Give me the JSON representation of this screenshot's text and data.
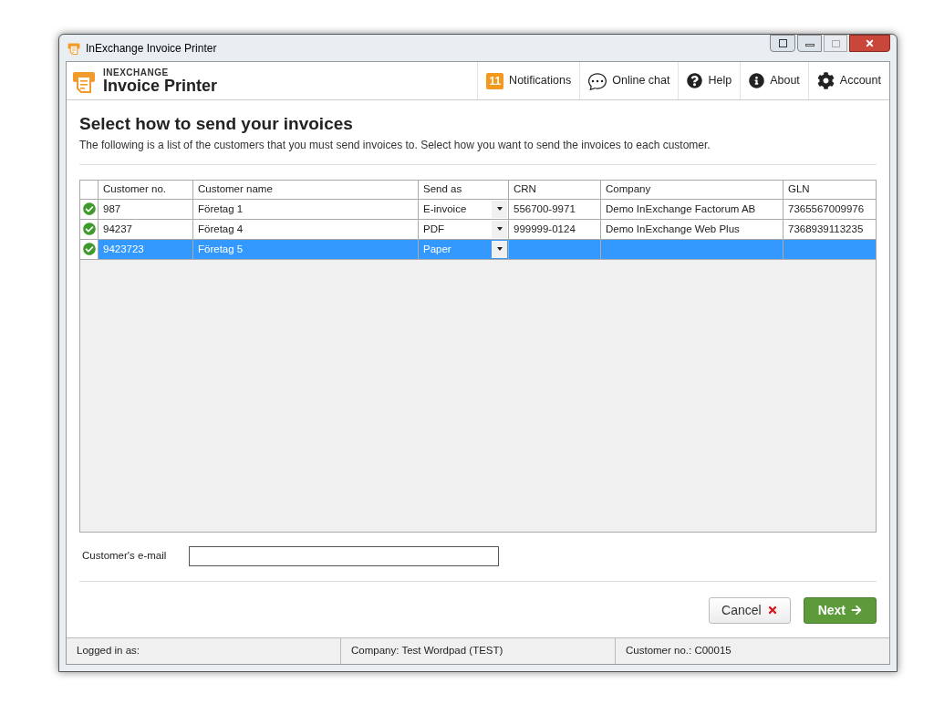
{
  "window": {
    "title": "InExchange Invoice Printer"
  },
  "brand": {
    "top": "INEXCHANGE",
    "name": "Invoice Printer"
  },
  "nav": [
    {
      "kind": "notifications",
      "badge": "11",
      "label": "Notifications"
    },
    {
      "kind": "chat",
      "label": "Online chat"
    },
    {
      "kind": "help",
      "label": "Help"
    },
    {
      "kind": "about",
      "label": "About"
    },
    {
      "kind": "account",
      "label": "Account"
    }
  ],
  "heading": "Select how to send your invoices",
  "subtitle": "The following is a list of the customers that you must send invoices to. Select how you want to send the invoices to each customer.",
  "table": {
    "columns": [
      "Customer no.",
      "Customer name",
      "Send as",
      "CRN",
      "Company",
      "GLN"
    ],
    "rows": [
      {
        "valid": true,
        "selected": false,
        "customer_no": "987",
        "customer_name": "Företag 1",
        "send_as": "E-invoice",
        "crn": "556700-9971",
        "company": "Demo InExchange Factorum AB",
        "gln": "7365567009976"
      },
      {
        "valid": true,
        "selected": false,
        "customer_no": "94237",
        "customer_name": "Företag 4",
        "send_as": "PDF",
        "crn": "999999-0124",
        "company": "Demo InExchange Web Plus",
        "gln": "7368939113235"
      },
      {
        "valid": true,
        "selected": true,
        "customer_no": "9423723",
        "customer_name": "Företag 5",
        "send_as": "Paper",
        "crn": "",
        "company": "",
        "gln": ""
      }
    ]
  },
  "email": {
    "label": "Customer's e-mail"
  },
  "buttons": {
    "cancel": "Cancel",
    "next": "Next"
  },
  "status_bar": [
    "Logged in as:",
    "Company: Test Wordpad (TEST)",
    "Customer no.: C00015"
  ]
}
